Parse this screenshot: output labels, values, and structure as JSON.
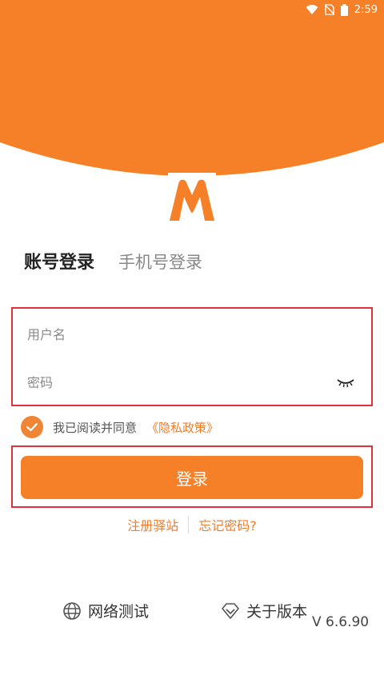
{
  "status_bar": {
    "time": "2:59",
    "icons": [
      "wifi-icon",
      "no-sim-icon",
      "battery-icon"
    ]
  },
  "colors": {
    "brand_orange": "#F58027",
    "error_outline": "#E0303A",
    "link_orange": "#F07D2B"
  },
  "logo": {
    "icon": "m-logo-icon"
  },
  "tabs": {
    "account_login": "账号登录",
    "phone_login": "手机号登录"
  },
  "form": {
    "username_placeholder": "用户名",
    "password_placeholder": "密码",
    "username_value": "",
    "password_value": ""
  },
  "agreement": {
    "text": "我已阅读并同意",
    "privacy_link": "《隐私政策》",
    "checked": true
  },
  "login_button": "登录",
  "links": {
    "register": "注册驿站",
    "forgot_password": "忘记密码?"
  },
  "bottom": {
    "network_test": "网络测试",
    "about_version": "关于版本",
    "version": "V 6.6.90"
  }
}
